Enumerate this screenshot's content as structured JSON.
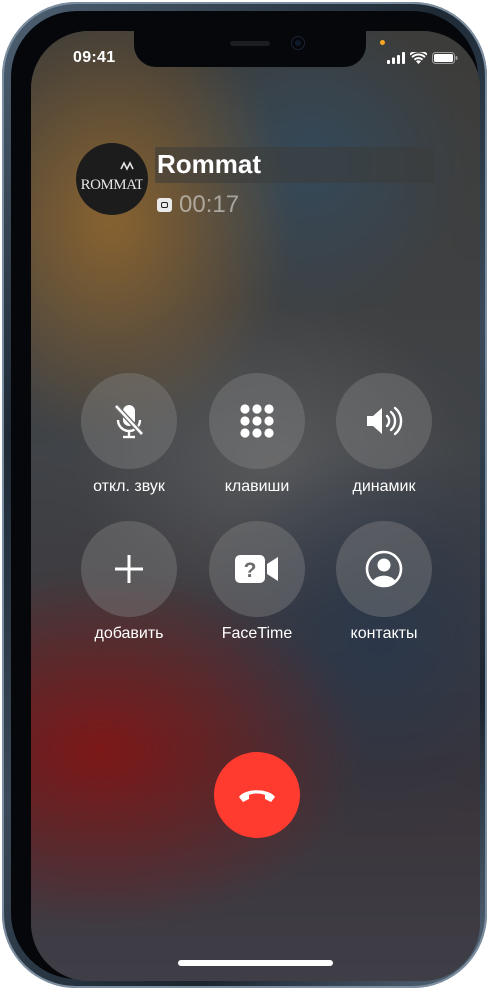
{
  "status_bar": {
    "time": "09:41",
    "icons": [
      "cellular-signal-icon",
      "wifi-icon",
      "battery-icon"
    ],
    "privacy_dot_color": "#f5a623"
  },
  "caller": {
    "name": "Rommat",
    "avatar_text": "ROMMAT",
    "duration": "00:17",
    "badge_icon": "recording-badge-icon"
  },
  "controls": [
    {
      "id": "mute",
      "label": "откл. звук",
      "icon": "mic-off-icon"
    },
    {
      "id": "keypad",
      "label": "клавиши",
      "icon": "keypad-icon"
    },
    {
      "id": "speaker",
      "label": "динамик",
      "icon": "speaker-icon"
    },
    {
      "id": "add",
      "label": "добавить",
      "icon": "plus-icon"
    },
    {
      "id": "facetime",
      "label": "FaceTime",
      "icon": "facetime-unknown-icon"
    },
    {
      "id": "contacts",
      "label": "контакты",
      "icon": "contact-icon"
    }
  ],
  "end_call": {
    "icon": "end-call-icon",
    "color": "#ff3b30"
  },
  "colors": {
    "button_bg": "rgba(130,130,132,0.42)",
    "text": "#ffffff"
  }
}
